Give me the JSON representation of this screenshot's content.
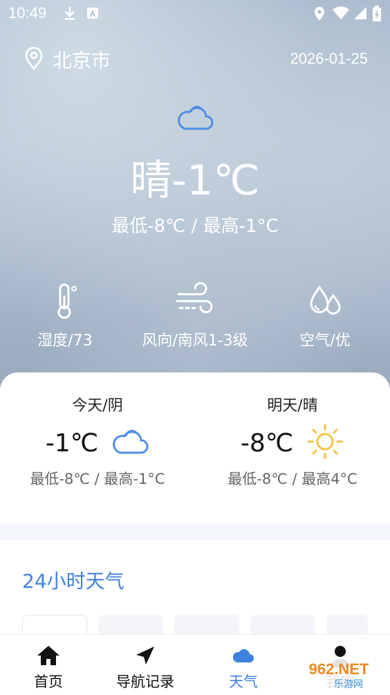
{
  "status_bar": {
    "time": "10:49",
    "icons": [
      "download-icon",
      "a-notification-icon",
      "location-icon",
      "wifi-icon",
      "signal-icon",
      "battery-charging-icon"
    ]
  },
  "header": {
    "location_icon": "map-pin-icon",
    "city": "北京市",
    "date": "2026-01-25"
  },
  "current": {
    "icon": "cloud-icon",
    "summary": "晴-1℃",
    "range": "最低-8℃ / 最高-1°C"
  },
  "stats": [
    {
      "icon": "thermometer-icon",
      "label": "湿度/73"
    },
    {
      "icon": "wind-icon",
      "label": "风向/南风1-3级"
    },
    {
      "icon": "drops-icon",
      "label": "空气/优"
    }
  ],
  "forecast": [
    {
      "label": "今天/阴",
      "temp": "-1℃",
      "icon": "cloud-icon",
      "range": "最低-8℃ / 最高-1°C"
    },
    {
      "label": "明天/晴",
      "temp": "-8℃",
      "icon": "sun-icon",
      "range": "最低-8℃ / 最高4°C"
    }
  ],
  "hourly": {
    "title": "24小时天气"
  },
  "nav": [
    {
      "label": "首页",
      "icon": "home-icon",
      "active": false
    },
    {
      "label": "导航记录",
      "icon": "navigation-arrow-icon",
      "active": false
    },
    {
      "label": "天气",
      "icon": "cloud-icon",
      "active": true
    },
    {
      "label": "我的",
      "icon": "user-icon",
      "active": false
    }
  ],
  "watermark": {
    "text": "962.NET",
    "subtext": "乐游网"
  },
  "colors": {
    "accent": "#3f82dd",
    "cloud_icon": "#4f8de6",
    "sun_icon": "#f5c342",
    "sky": "#a9b9cb"
  }
}
